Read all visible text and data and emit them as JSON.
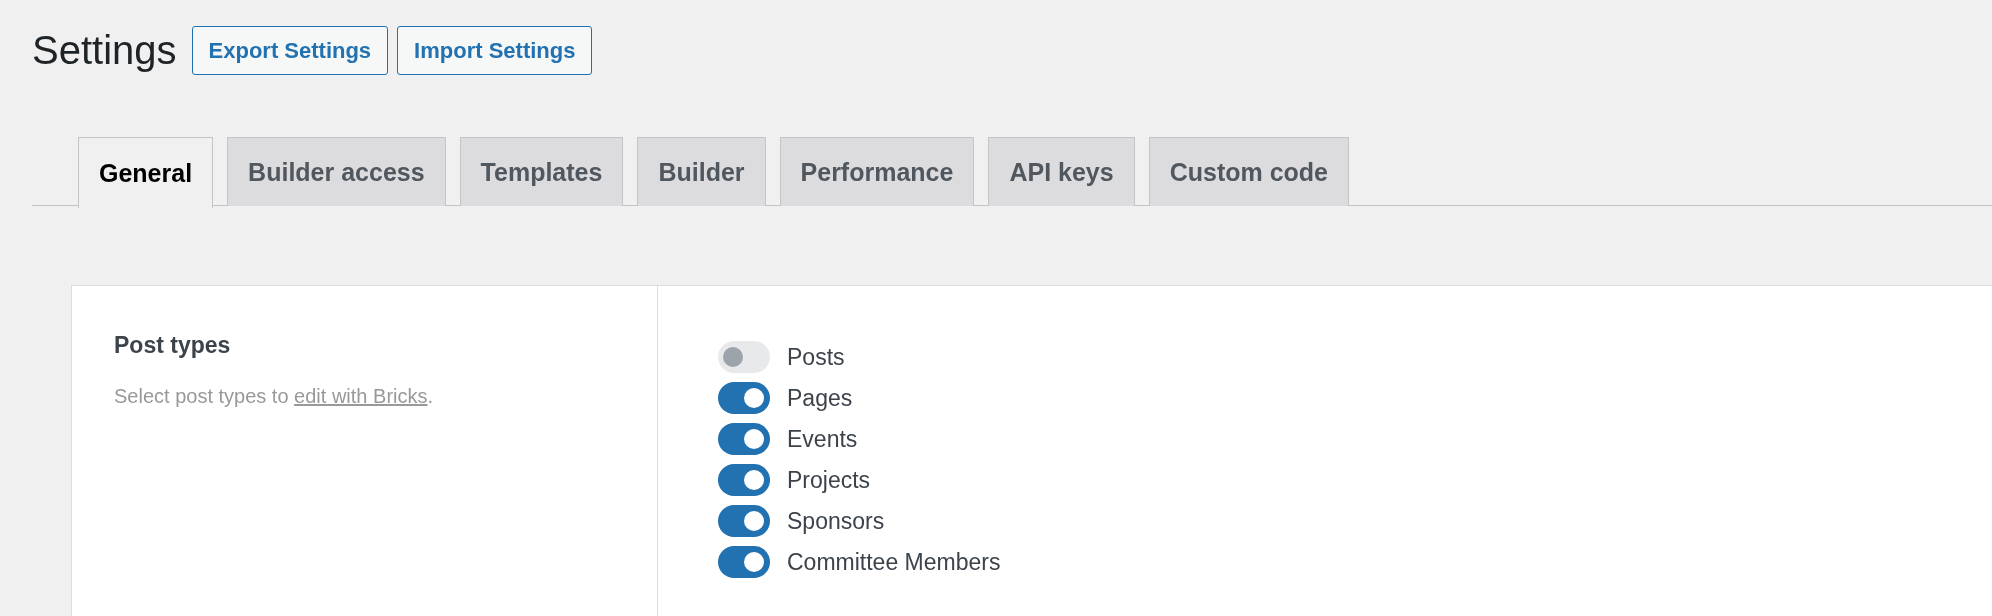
{
  "header": {
    "title": "Settings",
    "buttons": [
      "Export Settings",
      "Import Settings"
    ]
  },
  "tabs": [
    {
      "label": "General",
      "selected": true
    },
    {
      "label": "Builder access",
      "selected": false
    },
    {
      "label": "Templates",
      "selected": false
    },
    {
      "label": "Builder",
      "selected": false
    },
    {
      "label": "Performance",
      "selected": false
    },
    {
      "label": "API keys",
      "selected": false
    },
    {
      "label": "Custom code",
      "selected": false
    }
  ],
  "section": {
    "title": "Post types",
    "description": {
      "before": "Select post types to ",
      "link": "edit with Bricks",
      "after": "."
    },
    "post_types": [
      {
        "label": "Posts",
        "on": false
      },
      {
        "label": "Pages",
        "on": true
      },
      {
        "label": "Events",
        "on": true
      },
      {
        "label": "Projects",
        "on": true
      },
      {
        "label": "Sponsors",
        "on": true
      },
      {
        "label": "Committee Members",
        "on": true
      }
    ]
  }
}
